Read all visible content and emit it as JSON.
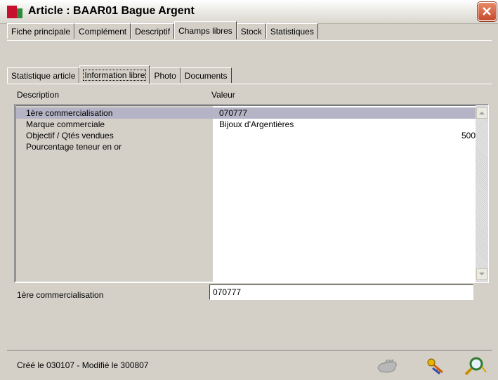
{
  "window": {
    "title": "Article : BAAR01 Bague Argent"
  },
  "tabs_main": [
    "Fiche principale",
    "Complément",
    "Descriptif",
    "Champs libres",
    "Stock",
    "Statistiques"
  ],
  "tabs_main_active": "Champs libres",
  "tabs_sub": [
    "Statistique article",
    "Information libre",
    "Photo",
    "Documents"
  ],
  "tabs_sub_active": "Information libre",
  "list": {
    "headers": {
      "description": "Description",
      "value": "Valeur"
    },
    "rows": [
      {
        "description": "1ère commercialisation",
        "value": "070777",
        "selected": true
      },
      {
        "description": "Marque commerciale",
        "value": "Bijoux d'Argentières"
      },
      {
        "description": "Objectif / Qtés vendues",
        "value": "500"
      },
      {
        "description": "Pourcentage teneur en or",
        "value": ""
      }
    ]
  },
  "edit": {
    "label": "1ère commercialisation",
    "value": "070777"
  },
  "status": {
    "text": "Créé le 030107 - Modifié le 300807"
  },
  "toolbar_icons": [
    "hand-icon",
    "keys-icon",
    "search-icon"
  ]
}
